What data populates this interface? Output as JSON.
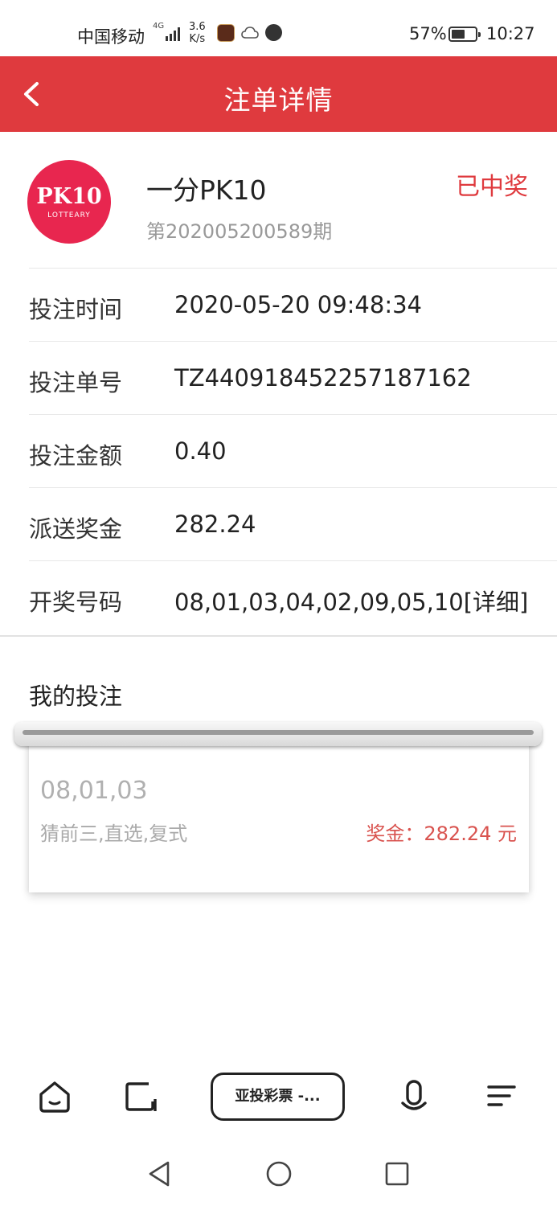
{
  "status_bar": {
    "carrier": "中国移动",
    "network": "4G",
    "speed_value": "3.6",
    "speed_unit": "K/s",
    "battery": "57%",
    "battery_level": 0.57,
    "time": "10:27"
  },
  "header": {
    "title": "注单详情",
    "back_icon": "chevron-left-icon"
  },
  "lottery": {
    "logo_main": "PK10",
    "logo_sub": "LOTTEARY",
    "name": "一分PK10",
    "period": "第202005200589期",
    "status": "已中奖"
  },
  "details": [
    {
      "label": "投注时间",
      "value": "2020-05-20 09:48:34"
    },
    {
      "label": "投注单号",
      "value": "TZ440918452257187162"
    },
    {
      "label": "投注金额",
      "value": "0.40"
    },
    {
      "label": "派送奖金",
      "value": "282.24"
    },
    {
      "label": "开奖号码",
      "value": "08,01,03,04,02,09,05,10[详细]"
    }
  ],
  "my_bets": {
    "title": "我的投注",
    "ticket": {
      "numbers": "08,01,03",
      "play_type": "猜前三,直选,复式",
      "prize": "奖金：282.24 元"
    }
  },
  "browser_bar": {
    "tab_label": "亚投彩票 -..."
  },
  "colors": {
    "accent": "#df3a3e",
    "logo": "#e8264f",
    "prize_text": "#d9534f"
  }
}
